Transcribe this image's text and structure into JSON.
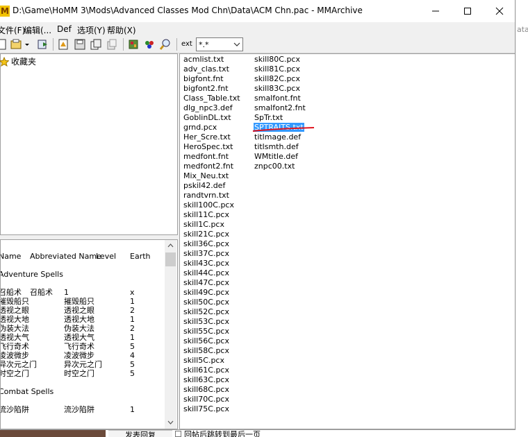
{
  "window": {
    "title": "D:\\Game\\HoMM 3\\Mods\\Advanced Classes Mod Chn\\Data\\ACM Chn.pac - MMArchive",
    "app_icon_letter": "M"
  },
  "menu": [
    "文件(F)",
    "编辑(...",
    "Def",
    "选项(Y)",
    "帮助(X)"
  ],
  "toolbar": {
    "ext_label": "ext",
    "ext_value": "*.*"
  },
  "favorites": {
    "label": "收藏夹"
  },
  "spell_table": {
    "headers": [
      "Name",
      "Abbreviated Name",
      "Level",
      "Earth"
    ],
    "sections": [
      {
        "title": "Adventure Spells",
        "rows": [
          [
            "召船术",
            "召船术",
            "1",
            "x"
          ],
          [
            "摧毁船只",
            "摧毁船只",
            "1",
            "1"
          ],
          [
            "透视之眼",
            "透视之眼",
            "2",
            "1"
          ],
          [
            "透视大地",
            "透视大地",
            "1",
            "1"
          ],
          [
            "伪装大法",
            "伪装大法",
            "2",
            "1"
          ],
          [
            "透视大气",
            "透视大气",
            "1",
            "1"
          ],
          [
            "飞行奇术",
            "飞行奇术",
            "5",
            "1"
          ],
          [
            "凌波微步",
            "凌波微步",
            "4",
            "1"
          ],
          [
            "异次元之门",
            "异次元之门",
            "5",
            "1"
          ],
          [
            "时空之门",
            "时空之门",
            "5",
            "1"
          ]
        ]
      },
      {
        "title": "Combat Spells",
        "rows": [
          [
            "流沙陷阱",
            "流沙陷阱",
            "1",
            "1"
          ]
        ]
      }
    ]
  },
  "files": {
    "column1": [
      "acmlist.txt",
      "adv_clas.txt",
      "bigfont.fnt",
      "bigfont2.fnt",
      "Class_Table.txt",
      "dlg_npc3.def",
      "GoblinDL.txt",
      "grnd.pcx",
      "Her_Scre.txt",
      "HeroSpec.txt",
      "medfont.fnt",
      "medfont2.fnt",
      "Mix_Neu.txt",
      "pskil42.def",
      "randtvrn.txt",
      "skill100C.pcx",
      "skill11C.pcx",
      "skill1C.pcx",
      "skill21C.pcx",
      "skill36C.pcx",
      "skill37C.pcx",
      "skill43C.pcx",
      "skill44C.pcx",
      "skill47C.pcx",
      "skill49C.pcx",
      "skill50C.pcx",
      "skill52C.pcx",
      "skill53C.pcx",
      "skill55C.pcx",
      "skill56C.pcx",
      "skill58C.pcx",
      "skill5C.pcx",
      "skill61C.pcx",
      "skill63C.pcx",
      "skill68C.pcx",
      "skill70C.pcx",
      "skill75C.pcx"
    ],
    "column2": [
      "skill80C.pcx",
      "skill81C.pcx",
      "skill82C.pcx",
      "skill83C.pcx",
      "smalfont.fnt",
      "smalfont2.fnt",
      "SpTr.txt",
      "SPTRAITS.txt",
      "titlmage.def",
      "titlsmth.def",
      "WMtitle.def",
      "znpc00.txt"
    ],
    "selected": "SPTRAITS.txt"
  },
  "background": {
    "right_fragment": "ata",
    "reply_button": "发表回复",
    "jump_checkbox_label": "回帖后跳转到最后一页"
  },
  "colors": {
    "selection": "#3399ff",
    "annotation": "#e0141e",
    "app_icon": "#f2c200"
  },
  "icons": [
    "app-icon",
    "minimize-icon",
    "maximize-icon",
    "close-icon",
    "new-archive-icon",
    "open-archive-icon",
    "extract-icon",
    "add-file-icon",
    "save-icon",
    "copy-icon",
    "delete-icon",
    "cube-icon",
    "palette-icon",
    "search-icon",
    "star-icon",
    "chevron-down-icon"
  ]
}
